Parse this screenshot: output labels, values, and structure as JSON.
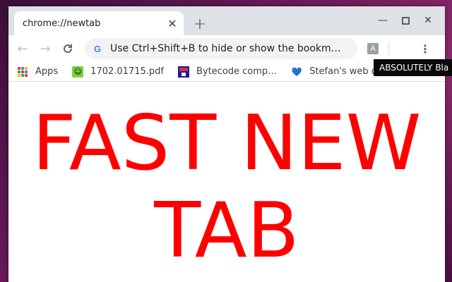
{
  "tab": {
    "title": "chrome://newtab",
    "close_icon": "close-icon"
  },
  "toolbar": {
    "omnibox_text": "Use Ctrl+Shift+B to hide or show the bookm…",
    "extension_label": "A"
  },
  "bookmarks": [
    {
      "label": "Apps",
      "icon": "apps-grid-icon"
    },
    {
      "label": "1702.01715.pdf",
      "icon": "smiley-icon"
    },
    {
      "label": "Bytecode comp…",
      "icon": "floppy-icon"
    },
    {
      "label": "Stefan's web d…",
      "icon": "heart-icon"
    }
  ],
  "tooltip": "ABSOLUTELY Bla",
  "content": {
    "line1": "FAST NEW",
    "line2": "TAB"
  },
  "colors": {
    "accent": "#ff0000",
    "tabstrip": "#dee1e6",
    "omnibox": "#f1f3f4"
  }
}
